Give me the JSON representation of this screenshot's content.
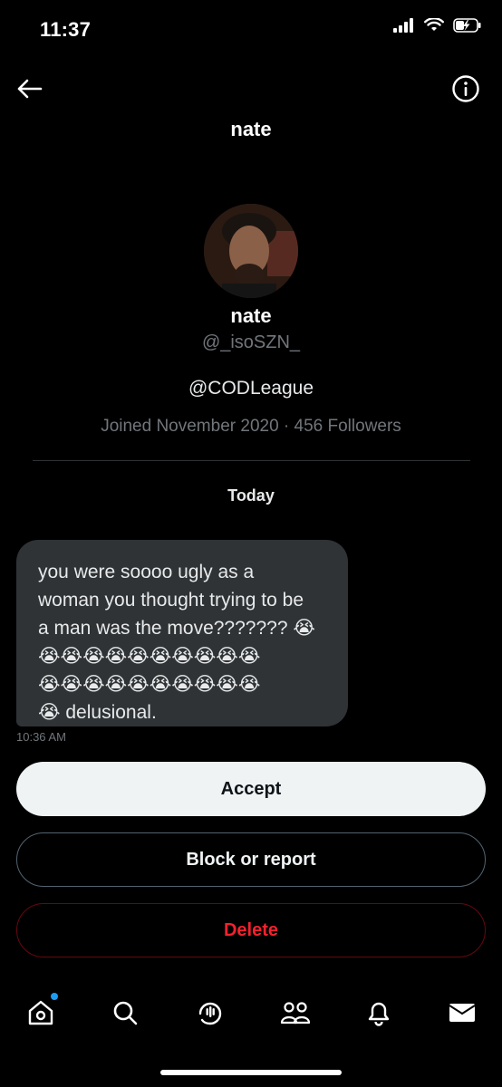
{
  "status_bar": {
    "time": "11:37",
    "signal_icon": "cellular-signal-icon",
    "wifi_icon": "wifi-icon",
    "battery_icon": "battery-charging-icon"
  },
  "header": {
    "title": "nate",
    "back_icon": "arrow-left-icon",
    "info_icon": "info-icon"
  },
  "profile": {
    "name": "nate",
    "handle": "@_isoSZN_",
    "bio": "@CODLeague",
    "meta": "Joined November 2020 · 456 Followers"
  },
  "conversation": {
    "date_label": "Today",
    "message": {
      "line1": "you were soooo ugly as a",
      "line2": "woman you thought trying to be",
      "line3": "a man was the move??????? 😭",
      "line4": "😭😭😭😭😭😭😭😭😭😭",
      "line5": "😭😭😭😭😭😭😭😭😭😭",
      "line6": "😭 delusional.",
      "time": "10:36 AM"
    }
  },
  "actions": {
    "accept_label": "Accept",
    "block_label": "Block or report",
    "delete_label": "Delete"
  },
  "colors": {
    "background": "#000000",
    "bubble": "#2f3336",
    "accept_bg": "#eff3f4",
    "delete_text": "#f4212e",
    "notification_dot": "#1d9bf0",
    "muted_text": "#71767b"
  },
  "bottom_nav": {
    "items": [
      "home-icon",
      "search-icon",
      "spaces-icon",
      "communities-icon",
      "notifications-icon",
      "messages-icon"
    ]
  }
}
